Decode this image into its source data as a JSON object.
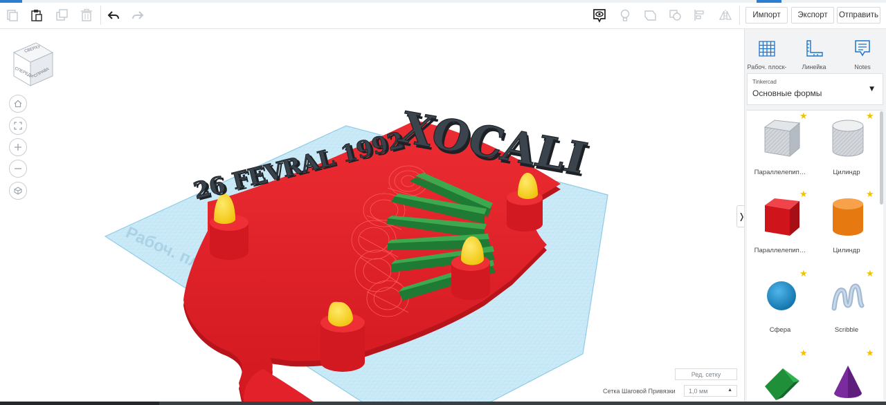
{
  "toolbar": {
    "import_label": "Импорт",
    "export_label": "Экспорт",
    "send_label": "Отправить"
  },
  "viewcube": {
    "top_label": "СВЕРХУ",
    "front_label": "СПЕРЕДИ",
    "right_label": "СПРАВА"
  },
  "scene": {
    "text_date": "26 FEVRAL 1992",
    "text_title": "XOCALI",
    "workplane_watermark": "Рабоч. пл.",
    "colors": {
      "base": "#e3212b",
      "text": "#2d3238",
      "flame": "#f4d316",
      "stripes": "#1f7a34",
      "grid": "#9ed6ee"
    }
  },
  "viewport": {
    "edit_grid_label": "Ред. сетку",
    "snap_label": "Сетка Шаговой Привязки",
    "snap_value": "1,0 мм"
  },
  "panel": {
    "workplane_label": "Рабоч. плоск-ть",
    "ruler_label": "Линейка",
    "notes_label": "Notes",
    "library_source": "Tinkercad",
    "library_name": "Основные формы",
    "shapes": [
      {
        "label": "Параллелепип…",
        "icon": "box-transparent-icon"
      },
      {
        "label": "Цилиндр",
        "icon": "cylinder-transparent-icon"
      },
      {
        "label": "Параллелепип…",
        "icon": "box-red-icon"
      },
      {
        "label": "Цилиндр",
        "icon": "cylinder-orange-icon"
      },
      {
        "label": "Сфера",
        "icon": "sphere-icon"
      },
      {
        "label": "Scribble",
        "icon": "scribble-icon"
      },
      {
        "label": "",
        "icon": "roof-icon"
      },
      {
        "label": "",
        "icon": "cone-icon"
      }
    ]
  }
}
